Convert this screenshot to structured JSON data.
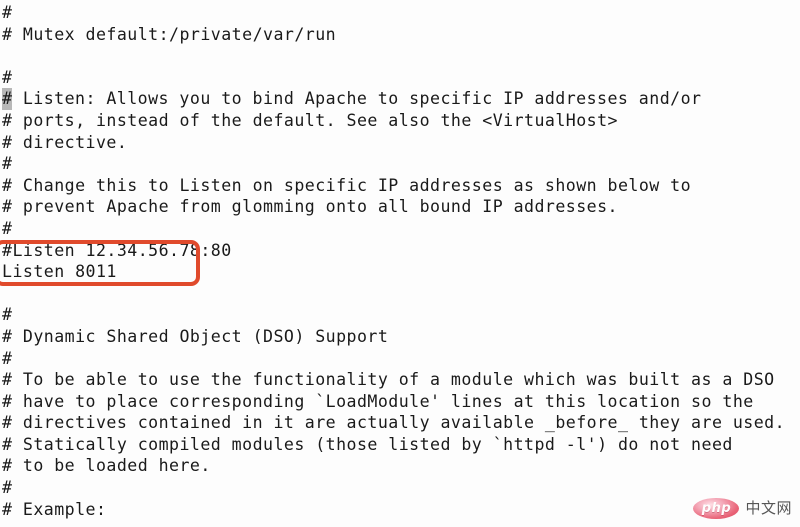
{
  "editor": {
    "name": "apache-httpd-conf-editor",
    "background_color": "#fdfdfd",
    "text_color": "#1a1a1a",
    "cursor_color": "#b8b8b8",
    "lines": [
      {
        "text": "#"
      },
      {
        "text": "# Mutex default:/private/var/run"
      },
      {
        "text": ""
      },
      {
        "text": "#"
      },
      {
        "text": "# Listen: Allows you to bind Apache to specific IP addresses and/or",
        "cursor": true
      },
      {
        "text": "# ports, instead of the default. See also the <VirtualHost>"
      },
      {
        "text": "# directive."
      },
      {
        "text": "#"
      },
      {
        "text": "# Change this to Listen on specific IP addresses as shown below to"
      },
      {
        "text": "# prevent Apache from glomming onto all bound IP addresses."
      },
      {
        "text": "#"
      },
      {
        "text": "#Listen 12.34.56.78:80"
      },
      {
        "text": "Listen 8011"
      },
      {
        "text": ""
      },
      {
        "text": "#"
      },
      {
        "text": "# Dynamic Shared Object (DSO) Support"
      },
      {
        "text": "#"
      },
      {
        "text": "# To be able to use the functionality of a module which was built as a DSO"
      },
      {
        "text": "# have to place corresponding `LoadModule' lines at this location so the"
      },
      {
        "text": "# directives contained in it are actually available _before_ they are used."
      },
      {
        "text": "# Statically compiled modules (those listed by `httpd -l') do not need"
      },
      {
        "text": "# to be loaded here."
      },
      {
        "text": "#"
      },
      {
        "text": "# Example:"
      }
    ]
  },
  "annotation": {
    "type": "rounded-rectangle-highlight",
    "color": "#e04a2c",
    "border_width_px": 4,
    "encloses": "Listen 8011"
  },
  "watermark": {
    "badge_label": "php",
    "site_label": "中文网",
    "badge_color": "#e8596e",
    "text_color": "#4a4a4a"
  }
}
